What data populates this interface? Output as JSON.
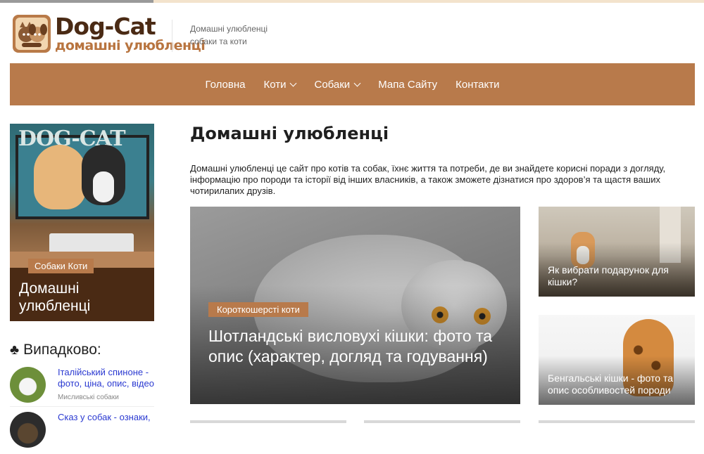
{
  "logo": {
    "title": "Dog-Cat",
    "subtitle": "домашні улюбленці"
  },
  "tagline": {
    "line1": "Домашні улюбленці",
    "line2": "собаки та коти"
  },
  "nav": [
    {
      "label": "Головна",
      "dropdown": false
    },
    {
      "label": "Коти",
      "dropdown": true
    },
    {
      "label": "Собаки",
      "dropdown": true
    },
    {
      "label": "Мапа Сайту",
      "dropdown": false
    },
    {
      "label": "Контакти",
      "dropdown": false
    }
  ],
  "promo": {
    "image_text": "DOG-CAT",
    "tag": "Собаки Коти",
    "title": "Домашні улюбленці"
  },
  "random": {
    "icon": "club-icon",
    "title": "Випадково:",
    "items": [
      {
        "title": "Італійський спиноне - фото, ціна, опис, відео",
        "category": "Мисливські собаки"
      },
      {
        "title": "Сказ у собак - ознаки,",
        "category": ""
      }
    ]
  },
  "main": {
    "title": "Домашні улюбленці",
    "intro": "Домашні улюбленці це сайт про котів та собак, їхнє життя та потреби, де ви знайдете корисні поради з догляду, інформацію про породи та історії від інших власників, а також зможете дізнатися про здоров’я та щастя ваших чотирилапих друзів."
  },
  "featured": {
    "tag": "Короткошерсті коти",
    "title": "Шотландські висловухі кішки: фото та опис (характер, догляд та годування)"
  },
  "side_cards": [
    {
      "title": "Як вибрати подарунок для кішки?"
    },
    {
      "title": "Бенгальські кішки - фото та опис особливостей породи"
    }
  ],
  "colors": {
    "accent": "#b87a4b",
    "brand_dark": "#4a2a14",
    "link": "#2b3ad1"
  }
}
